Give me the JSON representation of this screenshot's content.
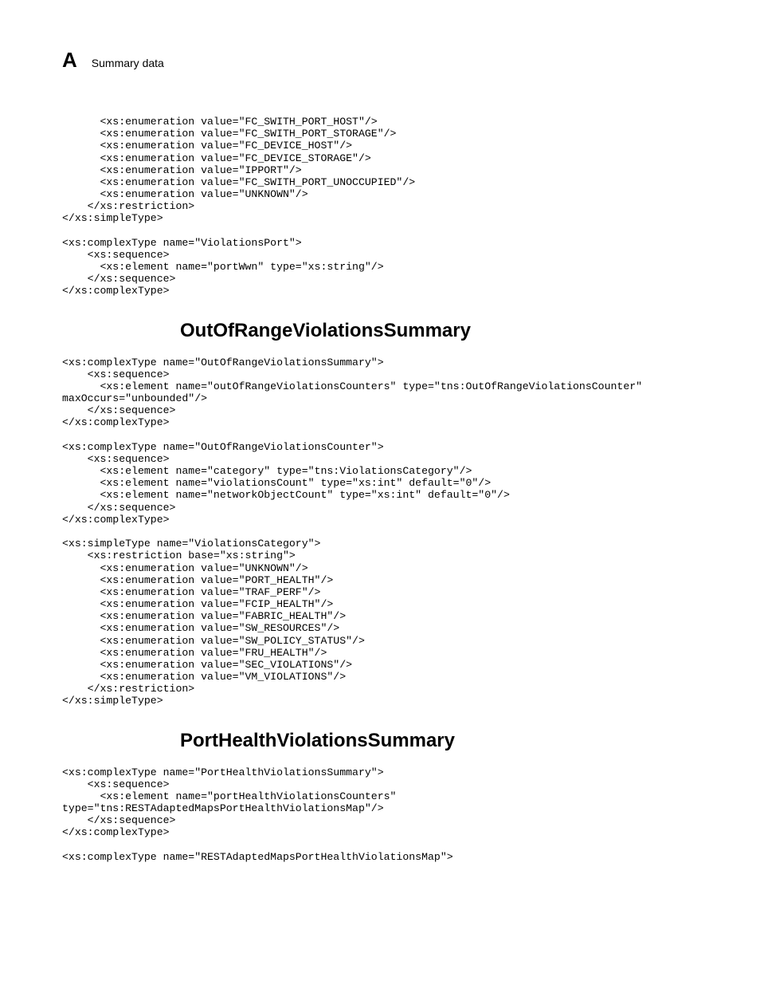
{
  "header": {
    "letter": "A",
    "title": "Summary data"
  },
  "code1": "      <xs:enumeration value=\"FC_SWITH_PORT_HOST\"/>\n      <xs:enumeration value=\"FC_SWITH_PORT_STORAGE\"/>\n      <xs:enumeration value=\"FC_DEVICE_HOST\"/>\n      <xs:enumeration value=\"FC_DEVICE_STORAGE\"/>\n      <xs:enumeration value=\"IPPORT\"/>\n      <xs:enumeration value=\"FC_SWITH_PORT_UNOCCUPIED\"/>\n      <xs:enumeration value=\"UNKNOWN\"/>\n    </xs:restriction>\n</xs:simpleType>\n\n<xs:complexType name=\"ViolationsPort\">\n    <xs:sequence>\n      <xs:element name=\"portWwn\" type=\"xs:string\"/>\n    </xs:sequence>\n</xs:complexType>",
  "heading1": "OutOfRangeViolationsSummary",
  "code2": "<xs:complexType name=\"OutOfRangeViolationsSummary\">\n    <xs:sequence>\n      <xs:element name=\"outOfRangeViolationsCounters\" type=\"tns:OutOfRangeViolationsCounter\" \nmaxOccurs=\"unbounded\"/>\n    </xs:sequence>\n</xs:complexType>\n\n<xs:complexType name=\"OutOfRangeViolationsCounter\">\n    <xs:sequence>\n      <xs:element name=\"category\" type=\"tns:ViolationsCategory\"/>\n      <xs:element name=\"violationsCount\" type=\"xs:int\" default=\"0\"/>\n      <xs:element name=\"networkObjectCount\" type=\"xs:int\" default=\"0\"/>\n    </xs:sequence>\n</xs:complexType>\n\n<xs:simpleType name=\"ViolationsCategory\">\n    <xs:restriction base=\"xs:string\">\n      <xs:enumeration value=\"UNKNOWN\"/>\n      <xs:enumeration value=\"PORT_HEALTH\"/>\n      <xs:enumeration value=\"TRAF_PERF\"/>\n      <xs:enumeration value=\"FCIP_HEALTH\"/>\n      <xs:enumeration value=\"FABRIC_HEALTH\"/>\n      <xs:enumeration value=\"SW_RESOURCES\"/>\n      <xs:enumeration value=\"SW_POLICY_STATUS\"/>\n      <xs:enumeration value=\"FRU_HEALTH\"/>\n      <xs:enumeration value=\"SEC_VIOLATIONS\"/>\n      <xs:enumeration value=\"VM_VIOLATIONS\"/>\n    </xs:restriction>\n</xs:simpleType>",
  "heading2": "PortHealthViolationsSummary",
  "code3": "<xs:complexType name=\"PortHealthViolationsSummary\">\n    <xs:sequence>\n      <xs:element name=\"portHealthViolationsCounters\" \ntype=\"tns:RESTAdaptedMapsPortHealthViolationsMap\"/>\n    </xs:sequence>\n</xs:complexType>\n\n<xs:complexType name=\"RESTAdaptedMapsPortHealthViolationsMap\">"
}
